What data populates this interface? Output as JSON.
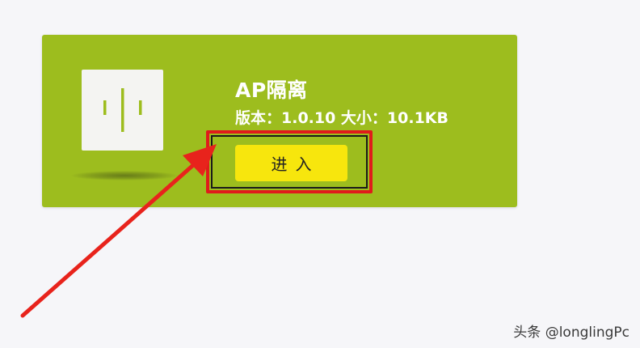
{
  "plugin": {
    "title": "AP隔离",
    "meta": "版本：1.0.10  大小：10.1KB",
    "enter_label": "进入",
    "icon": "voice-wave-icon",
    "card_color": "#9dbd1e",
    "button_color": "#f7e60d"
  },
  "annotation": {
    "highlight_color": "#e01b1b",
    "arrow_color": "#e8231c"
  },
  "watermark": {
    "text": "头条 @longlingPc"
  }
}
